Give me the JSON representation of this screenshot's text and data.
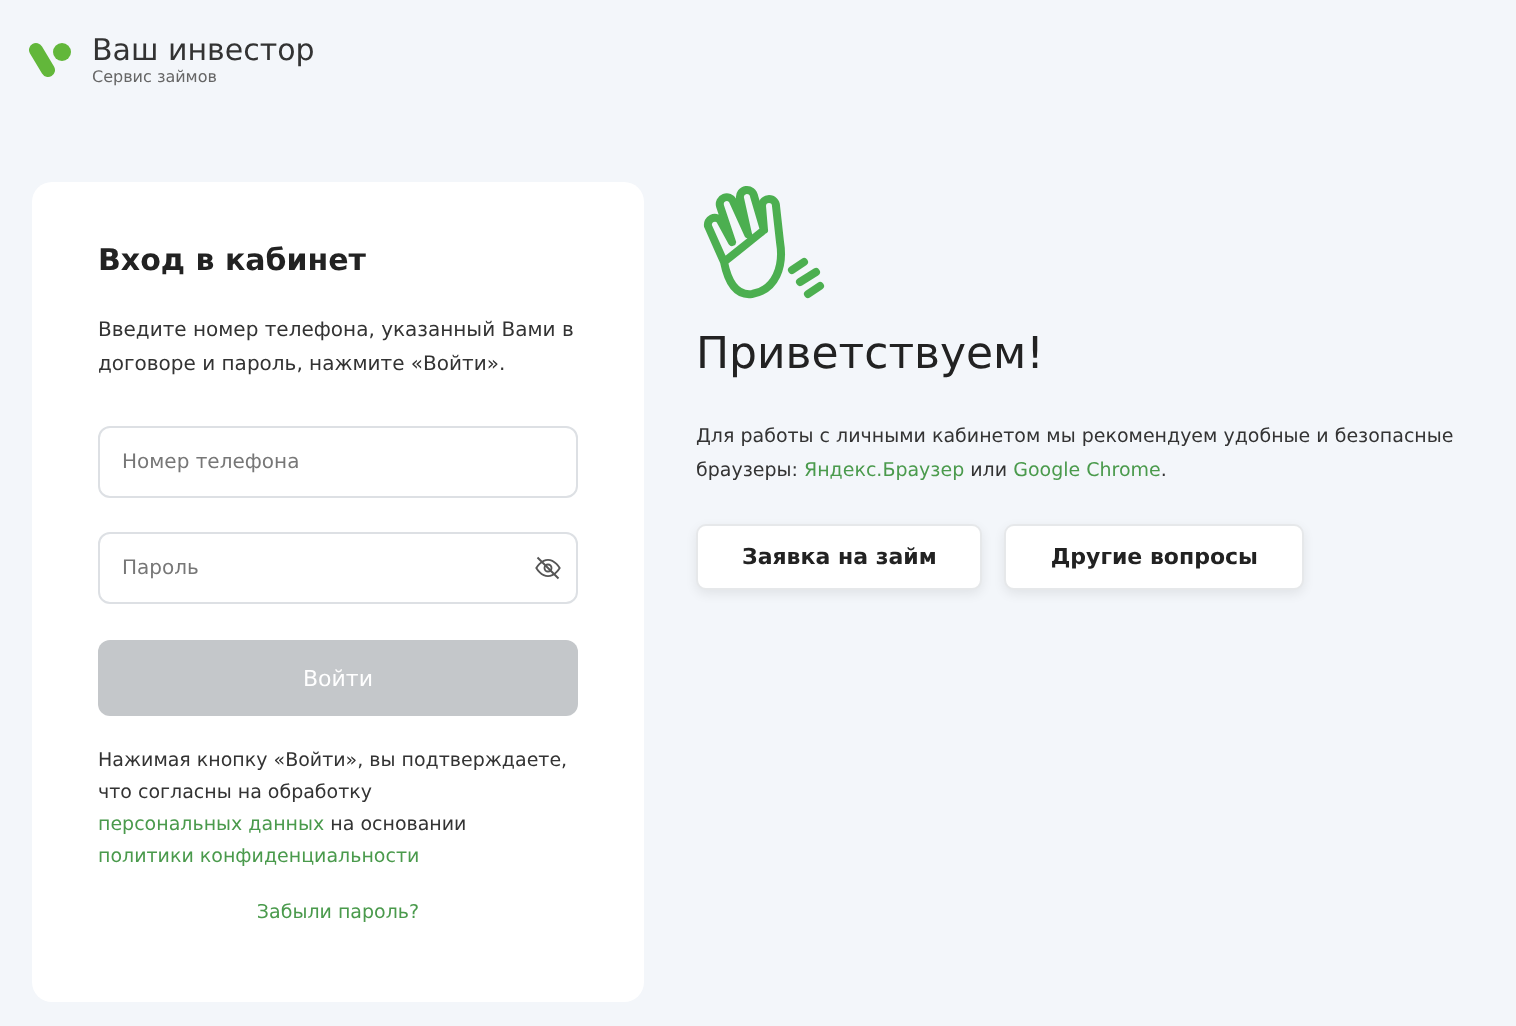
{
  "brand": {
    "name": "Ваш инвестор",
    "tagline": "Сервис займов"
  },
  "login": {
    "title": "Вход в кабинет",
    "intro": "Введите номер телефона, указанный Вами в договоре и пароль, нажмите «Войти».",
    "fields": [
      {
        "placeholder": "Номер телефона",
        "kind": "text"
      },
      {
        "placeholder": "Пароль",
        "kind": "password"
      }
    ],
    "submit": {
      "label": "Войти",
      "disabled": true
    },
    "consent": [
      {
        "kind": "text",
        "text": "Нажимая кнопку «Войти», вы подтверждаете, что согласны на обработку "
      },
      {
        "kind": "link",
        "text": "персональных данных"
      },
      {
        "kind": "text",
        "text": " на основании "
      },
      {
        "kind": "link",
        "text": "политики конфиденциальности"
      }
    ],
    "forgot": "Забыли пароль?"
  },
  "welcome": {
    "title": "Приветствуем!",
    "text": [
      {
        "kind": "text",
        "text": "Для работы с личными кабинетом мы рекомендуем удобные и безопасные браузеры: "
      },
      {
        "kind": "link",
        "text": "Яндекс.Браузер"
      },
      {
        "kind": "text",
        "text": " или "
      },
      {
        "kind": "link",
        "text": "Google Chrome"
      },
      {
        "kind": "text",
        "text": "."
      }
    ],
    "buttons": [
      "Заявка на займ",
      "Другие вопросы"
    ]
  }
}
